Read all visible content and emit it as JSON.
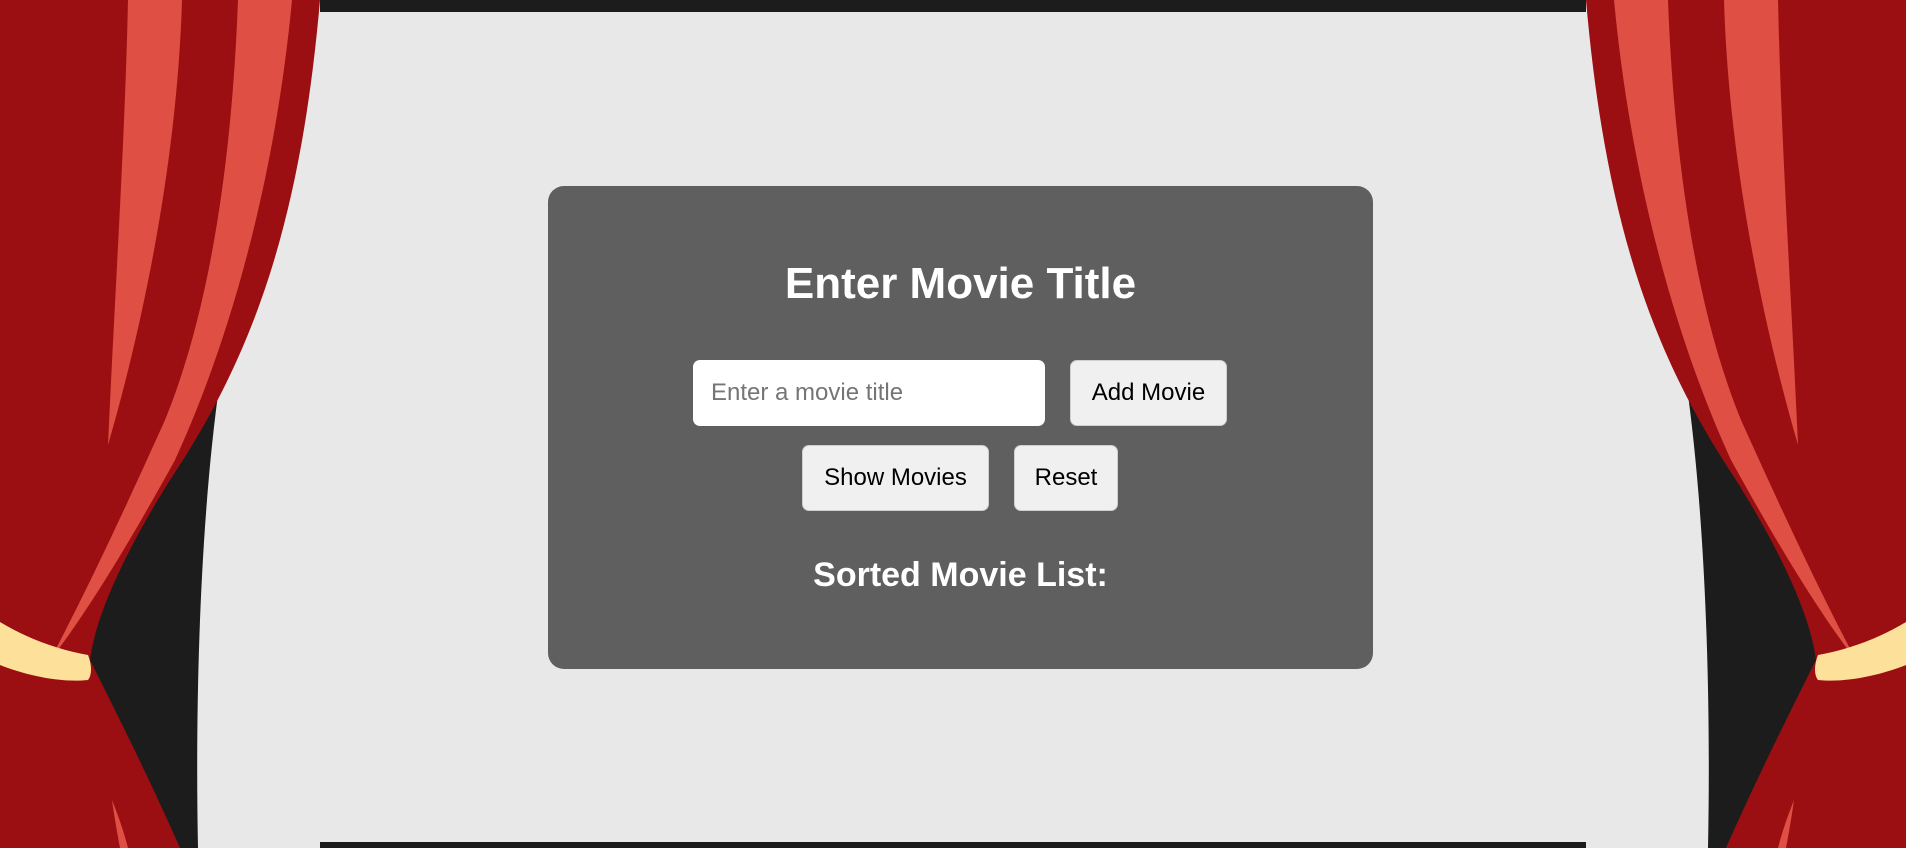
{
  "panel": {
    "title": "Enter Movie Title",
    "input": {
      "placeholder": "Enter a movie title",
      "value": ""
    },
    "buttons": {
      "add_label": "Add Movie",
      "show_label": "Show Movies",
      "reset_label": "Reset"
    },
    "list_heading": "Sorted Movie List:",
    "movies": []
  },
  "colors": {
    "page_background": "#e8e8e8",
    "panel_background": "#5f5f5f",
    "curtain_dark_red": "#9b0f12",
    "curtain_light_red": "#df4f43",
    "curtain_tieback": "#fde09a",
    "stage_black": "#1c1c1c"
  },
  "icons": {
    "left_curtain": "curtain-left-icon",
    "right_curtain": "curtain-right-icon"
  }
}
